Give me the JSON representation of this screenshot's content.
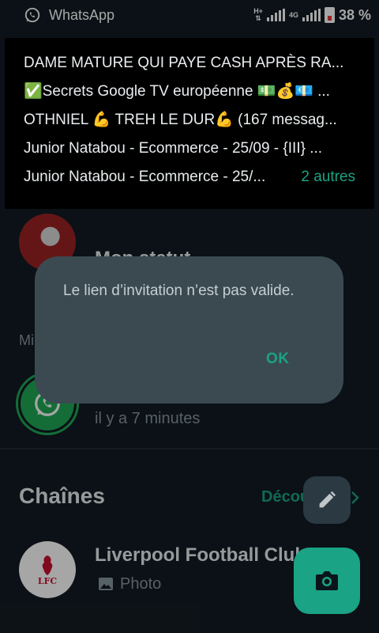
{
  "statusbar": {
    "app_name": "WhatsApp",
    "net_top": "H+",
    "net_second": "4G",
    "battery_pct": "38 %",
    "battery_color": "#e53935"
  },
  "notification": {
    "lines": [
      "DAME MATURE QUI PAYE CASH APRÈS RA...",
      "✅Secrets Google TV européenne 💵💰💶 ...",
      "OTHNIEL 💪 TREH LE DUR💪 (167 messag...",
      "Junior Natabou - Ecommerce - 25/09 - {III} ..."
    ],
    "last_line": "Junior Natabou - Ecommerce - 25/...",
    "more_label": "2 autres"
  },
  "status": {
    "my_status_title": "Mon statut",
    "section_label": "Mi",
    "whatsapp_status_time": "il y a 7 minutes"
  },
  "channels": {
    "title": "Chaînes",
    "discover_label": "Découvrir",
    "items": [
      {
        "name": "Liverpool Football Club",
        "preview": "Photo",
        "avatar_text": "LFC"
      }
    ]
  },
  "dialog": {
    "message": "Le lien d’invitation n’est pas valide.",
    "ok_label": "OK"
  },
  "colors": {
    "accent": "#1aa384",
    "background": "#121b22",
    "dialog_bg": "#3b4a51"
  },
  "icons": {
    "fab_small": "pencil-icon",
    "fab_big": "camera-icon",
    "statusbar_app": "whatsapp-icon"
  }
}
